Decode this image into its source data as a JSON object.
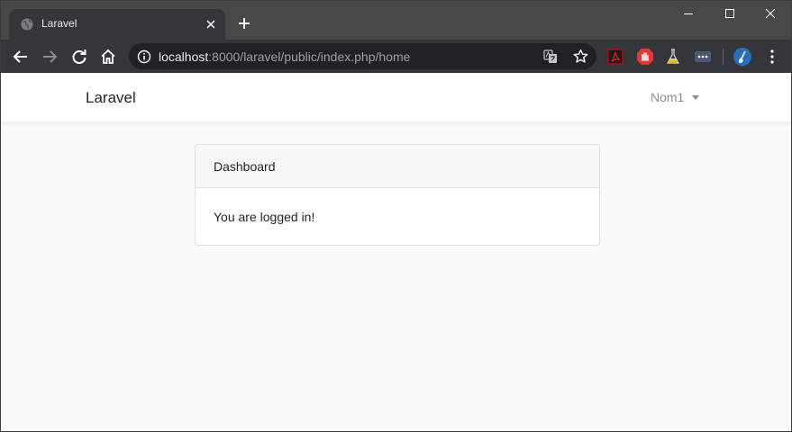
{
  "browser": {
    "tab": {
      "title": "Laravel"
    },
    "address": {
      "host": "localhost",
      "rest": ":8000/laravel/public/index.php/home"
    }
  },
  "app": {
    "brand": "Laravel",
    "user": {
      "name": "Nom1"
    }
  },
  "card": {
    "header": "Dashboard",
    "body": "You are logged in!"
  },
  "icons": {
    "back": "arrow-left-icon",
    "forward": "arrow-right-icon",
    "reload": "reload-icon",
    "home": "home-icon",
    "info": "info-icon",
    "translate": "translate-icon",
    "bookmark": "star-icon",
    "extensions": [
      "pdf-extension-icon",
      "adblock-extension-icon",
      "flask-extension-icon",
      "dots-extension-icon"
    ],
    "profile": "profile-avatar-icon",
    "menu": "kebab-menu-icon"
  }
}
